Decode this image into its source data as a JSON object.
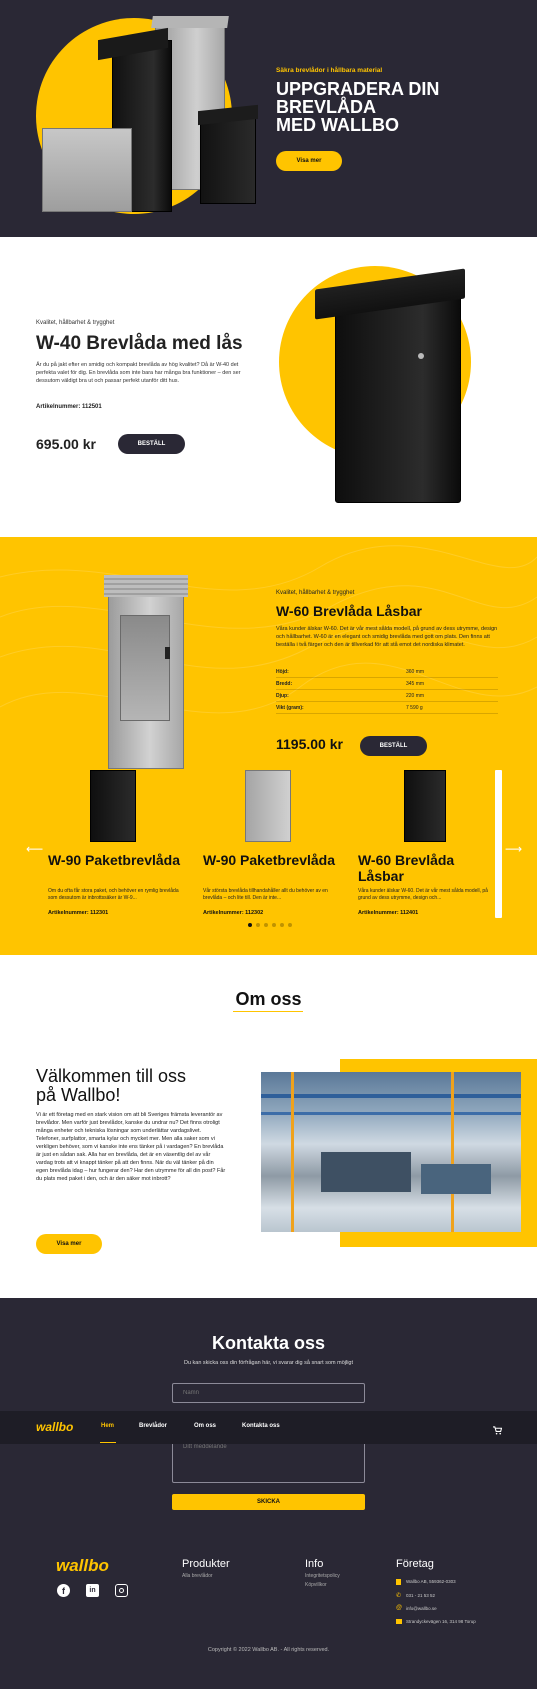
{
  "hero": {
    "eyebrow": "Säkra brevlådor i hållbara material",
    "title_line1": "UPPGRADERA DIN",
    "title_line2": "BREVLÅDA",
    "title_line3": "MED WALLBO",
    "cta": "Visa mer"
  },
  "product1": {
    "eyebrow": "Kvalitet, hållbarhet & trygghet",
    "title": "W-40 Brevlåda med lås",
    "description": "Är du på jakt efter en smidig och kompakt brevlåda av hög kvalitet? Då är W-40 det perfekta valet för dig. En brevlåda som inte bara har många bra funktioner – den ser dessutom väldigt bra ut och passar perfekt utanför ditt hus.",
    "article": "Artikelnummer: 112501",
    "price": "695.00 kr",
    "cta": "BESTÄLL"
  },
  "product2": {
    "eyebrow": "Kvalitet, hållbarhet & trygghet",
    "title": "W-60 Brevlåda Låsbar",
    "description": "Våra kunder älskar W-60. Det är vår mest sålda modell, på grund av dess utrymme, design och hållbarhet. W-60 är en elegant och smidig brevlåda med gott om plats. Den finns att beställa i två färger och den är tillverkad för att stå emot det nordiska klimatet.",
    "specs": [
      {
        "label": "Höjd:",
        "value": "360 mm"
      },
      {
        "label": "Bredd:",
        "value": "345 mm"
      },
      {
        "label": "Djup:",
        "value": "220 mm"
      },
      {
        "label": "Vikt (gram):",
        "value": "7 590 g"
      }
    ],
    "price": "1195.00 kr",
    "cta": "BESTÄLL"
  },
  "carousel": {
    "items": [
      {
        "title": "W-90 Paketbrevlåda",
        "desc": "Om du ofta får stora paket, och behöver en rymlig brevlåda som dessutom är inbrottssäker är W-9...",
        "article": "Artikelnummer: 112301"
      },
      {
        "title": "W-90 Paketbrevlåda",
        "desc": "Vår största brevlåda tillhandahåller allt du behöver av en brevlåda – och lite till. Den är inte...",
        "article": "Artikelnummer: 112302"
      },
      {
        "title": "W-60 Brevlåda Låsbar",
        "desc": "Våra kunder älskar W-60. Det är vår mest sålda modell, på grund av dess utrymme, design och...",
        "article": "Artikelnummer: 112401"
      }
    ],
    "prev_arrow": "⟵",
    "next_arrow": "⟶"
  },
  "about": {
    "section_title": "Om oss",
    "heading_line1": "Välkommen till oss",
    "heading_line2": "på Wallbo!",
    "body": "Vi är ett företag med en stark vision om att bli Sveriges främsta leverantör av brevlådor. Men varför just brevlådor, kanske du undrar nu? Det finns otroligt många enheter och tekniska lösningar som underlättar vardagslivet. Telefoner, surfplattor, smarta kylar och mycket mer. Men alla saker som vi verkligen behöver, som vi kanske inte ens tänker på i vardagen? En brevlåda är just en sådan sak. Alla har en brevlåda, det är en väsentlig del av vår vardag trots att vi knappt tänker på att den finns. När du väl tänker på din egen brevlåda idag – hur fungerar den? Har den utrymme för all din post? Får du plats med paket i den, och är den säker mot inbrott?",
    "cta": "Visa mer"
  },
  "contact": {
    "title": "Kontakta oss",
    "subtitle": "Du kan skicka oss din förfrågan här, vi svarar dig så snart som möjligt",
    "name_placeholder": "Namn",
    "message_placeholder": "Ditt meddelande",
    "submit": "SKICKA"
  },
  "nav": {
    "logo": "wallbo",
    "items": [
      "Hem",
      "Brevlådor",
      "Om oss",
      "Kontakta oss"
    ],
    "active_index": 0
  },
  "footer": {
    "logo": "wallbo",
    "products_title": "Produkter",
    "products_links": [
      "Alla brevlådor"
    ],
    "info_title": "Info",
    "info_links": [
      "Integritetspolicy",
      "Köpvillkor"
    ],
    "company_title": "Företag",
    "company_lines": [
      "Wallbo AB, 559362-0303",
      "031 - 21 53 52",
      "info@wallbo.se",
      "Strandyckevägen 16, 314 98 Torup"
    ],
    "copyright": "Copyright © 2022 Wallbo AB. - All rights reserved.",
    "social": [
      "facebook-icon",
      "linkedin-icon",
      "instagram-icon"
    ]
  },
  "colors": {
    "accent": "#ffc400",
    "dark": "#2a2835",
    "cart": "cart-icon"
  }
}
